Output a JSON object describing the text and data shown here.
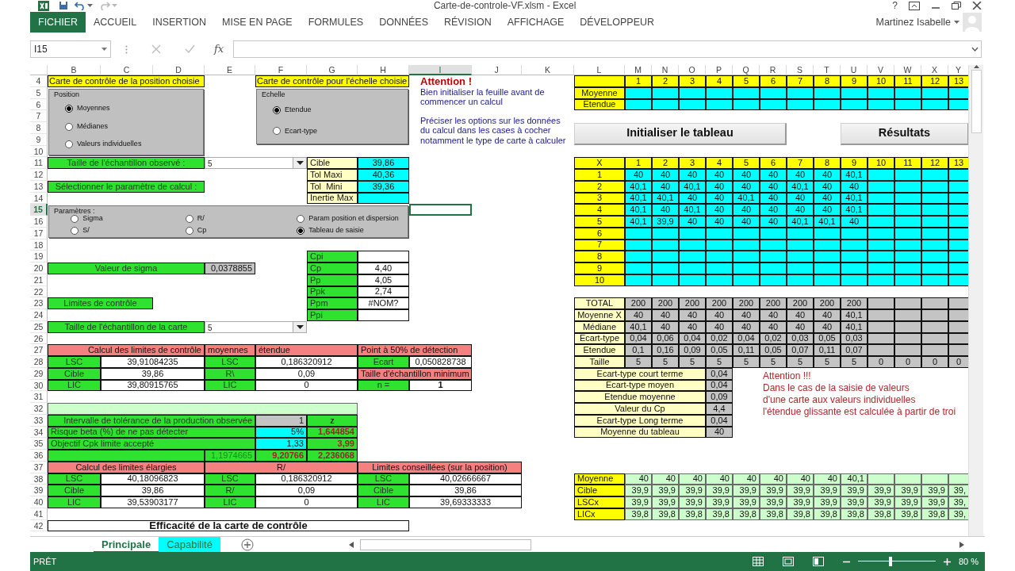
{
  "window": {
    "title": "Carte-de-controle-VF.xlsm - Excel",
    "help": "?"
  },
  "ribbon_tabs": [
    {
      "label": "FICHIER",
      "kind": "file"
    },
    {
      "label": "ACCUEIL",
      "kind": "tab"
    },
    {
      "label": "INSERTION",
      "kind": "tab"
    },
    {
      "label": "MISE EN PAGE",
      "kind": "tab"
    },
    {
      "label": "FORMULES",
      "kind": "tab"
    },
    {
      "label": "DONNÉES",
      "kind": "tab"
    },
    {
      "label": "RÉVISION",
      "kind": "tab"
    },
    {
      "label": "AFFICHAGE",
      "kind": "tab"
    },
    {
      "label": "DÉVELOPPEUR",
      "kind": "tab"
    }
  ],
  "user": "Martinez Isabelle",
  "formula_bar": {
    "name_box": "I15",
    "fx": "fx"
  },
  "columns": [
    {
      "label": "B",
      "selected": false
    },
    {
      "label": "C",
      "selected": false
    },
    {
      "label": "D",
      "selected": false
    },
    {
      "label": "E",
      "selected": false
    },
    {
      "label": "F",
      "selected": false
    },
    {
      "label": "G",
      "selected": false
    },
    {
      "label": "H",
      "selected": false
    },
    {
      "label": "I",
      "selected": true
    },
    {
      "label": "J",
      "selected": false
    },
    {
      "label": "K",
      "selected": false
    },
    {
      "label": "L",
      "selected": false
    },
    {
      "label": "M",
      "selected": false
    },
    {
      "label": "N",
      "selected": false
    },
    {
      "label": "O",
      "selected": false
    },
    {
      "label": "P",
      "selected": false
    },
    {
      "label": "Q",
      "selected": false
    },
    {
      "label": "R",
      "selected": false
    },
    {
      "label": "S",
      "selected": false
    },
    {
      "label": "T",
      "selected": false
    },
    {
      "label": "U",
      "selected": false
    },
    {
      "label": "V",
      "selected": false
    },
    {
      "label": "W",
      "selected": false
    },
    {
      "label": "X",
      "selected": false
    },
    {
      "label": "Y",
      "selected": false
    }
  ],
  "rows": [
    {
      "label": "4",
      "selected": false
    },
    {
      "label": "5",
      "selected": false
    },
    {
      "label": "6",
      "selected": false
    },
    {
      "label": "7",
      "selected": false
    },
    {
      "label": "8",
      "selected": false
    },
    {
      "label": "9",
      "selected": false
    },
    {
      "label": "10",
      "selected": false
    },
    {
      "label": "11",
      "selected": false
    },
    {
      "label": "12",
      "selected": false
    },
    {
      "label": "13",
      "selected": false
    },
    {
      "label": "14",
      "selected": false
    },
    {
      "label": "15",
      "selected": true
    },
    {
      "label": "16",
      "selected": false
    },
    {
      "label": "17",
      "selected": false
    },
    {
      "label": "18",
      "selected": false
    },
    {
      "label": "19",
      "selected": false
    },
    {
      "label": "20",
      "selected": false
    },
    {
      "label": "21",
      "selected": false
    },
    {
      "label": "22",
      "selected": false
    },
    {
      "label": "23",
      "selected": false
    },
    {
      "label": "24",
      "selected": false
    },
    {
      "label": "25",
      "selected": false
    },
    {
      "label": "26",
      "selected": false
    },
    {
      "label": "27",
      "selected": false
    },
    {
      "label": "28",
      "selected": false
    },
    {
      "label": "29",
      "selected": false
    },
    {
      "label": "30",
      "selected": false
    },
    {
      "label": "31",
      "selected": false
    },
    {
      "label": "32",
      "selected": false
    },
    {
      "label": "33",
      "selected": false
    },
    {
      "label": "34",
      "selected": false
    },
    {
      "label": "35",
      "selected": false
    },
    {
      "label": "36",
      "selected": false
    },
    {
      "label": "37",
      "selected": false
    },
    {
      "label": "38",
      "selected": false
    },
    {
      "label": "39",
      "selected": false
    },
    {
      "label": "40",
      "selected": false
    },
    {
      "label": "41",
      "selected": false
    },
    {
      "label": "42",
      "selected": false
    }
  ],
  "option_groups": [
    {
      "legend": "Position",
      "options": [
        {
          "label": "Moyennes",
          "selected": true
        },
        {
          "label": "Médianes",
          "selected": false
        },
        {
          "label": "Valeurs individuelles",
          "selected": false
        }
      ]
    },
    {
      "legend": "Echelle",
      "options": [
        {
          "label": "Etendue",
          "selected": true
        },
        {
          "label": "Ecart-type",
          "selected": false
        }
      ]
    },
    {
      "legend": "Paramètres :",
      "options": [
        {
          "label": "Sigma",
          "selected": false
        },
        {
          "label": "R/",
          "selected": false
        },
        {
          "label": "Param position et dispersion",
          "selected": false
        },
        {
          "label": "S/",
          "selected": false
        },
        {
          "label": "Cp",
          "selected": false
        },
        {
          "label": "Tableau de saisie",
          "selected": true
        }
      ]
    }
  ],
  "notes": [
    {
      "kind": "info",
      "heading": "Attention !",
      "paragraphs": [
        [
          "Bien initialiser la feuille avant de",
          "commencer un calcul"
        ],
        [
          "Préciser les options sur les données",
          "du calcul dans les cases à cocher",
          "notamment le type de carte à calculer"
        ]
      ]
    },
    {
      "kind": "alert",
      "heading": "Attention !!!",
      "paragraphs": [
        [
          "Dans le cas de la saisie de valeurs",
          "d'une carte aux valeurs individuelles",
          "l'étendue glissante est calculée à partir de troi"
        ]
      ]
    }
  ],
  "buttons": [
    {
      "label": "Initialiser le tableau"
    },
    {
      "label": "Résultats"
    }
  ],
  "cells": [
    {
      "kind": "title",
      "text": "Carte de contrôle de la position choisie"
    },
    {
      "kind": "title",
      "text": "Carte de contrôle pour l'échelle choisie"
    },
    {
      "kind": "green",
      "text": "Taille de l'échantillon observé :"
    },
    {
      "kind": "dropdown",
      "text": "5"
    },
    {
      "kind": "tan",
      "text": "Cible"
    },
    {
      "kind": "cyan",
      "text": "39,86"
    },
    {
      "kind": "tan",
      "text": "Tol Maxi"
    },
    {
      "kind": "cyan",
      "text": "40,36"
    },
    {
      "kind": "green",
      "text": "Sélectionner le paramètre de calcul :"
    },
    {
      "kind": "tan",
      "text": "Tol  Mini"
    },
    {
      "kind": "cyan",
      "text": "39,36"
    },
    {
      "kind": "tan",
      "text": "Inertie Max"
    },
    {
      "kind": "cyan"
    },
    {
      "kind": "green",
      "text": "Cpi"
    },
    {
      "kind": "white"
    },
    {
      "kind": "green",
      "text": "Valeur de sigma"
    },
    {
      "kind": "gray",
      "text": "0,0378855"
    },
    {
      "kind": "green",
      "text": "Cp"
    },
    {
      "kind": "white",
      "text": "4,40"
    },
    {
      "kind": "green",
      "text": "Pp"
    },
    {
      "kind": "white",
      "text": "4,05"
    },
    {
      "kind": "green",
      "text": "Ppk"
    },
    {
      "kind": "white",
      "text": "2,74"
    },
    {
      "kind": "green",
      "text": "Limites de contrôle"
    },
    {
      "kind": "green",
      "text": "Ppm"
    },
    {
      "kind": "white",
      "text": "#NOM?"
    },
    {
      "kind": "green",
      "text": "Ppi"
    },
    {
      "kind": "white"
    },
    {
      "kind": "green",
      "text": "Taille de l'échantillon de la carte"
    },
    {
      "kind": "dropdown",
      "text": "5"
    },
    {
      "kind": "pink",
      "text": "Calcul des limites de contrôle"
    },
    {
      "kind": "pink",
      "text": "moyennes"
    },
    {
      "kind": "pink",
      "text": "étendue"
    },
    {
      "kind": "pink",
      "text": "Point à 50% de détection"
    },
    {
      "kind": "green",
      "text": "LSC"
    },
    {
      "kind": "white",
      "text": "39,91084235"
    },
    {
      "kind": "green",
      "text": "LSC"
    },
    {
      "kind": "white",
      "text": "0,186320912"
    },
    {
      "kind": "green",
      "text": "Ecart"
    },
    {
      "kind": "white",
      "text": "0,050828738"
    },
    {
      "kind": "green",
      "text": "Cible"
    },
    {
      "kind": "white",
      "text": "39,86"
    },
    {
      "kind": "green",
      "text": "R\\"
    },
    {
      "kind": "white",
      "text": "0,09"
    },
    {
      "kind": "pink",
      "text": "Taille d'échantillon minimum"
    },
    {
      "kind": "green",
      "text": "LIC"
    },
    {
      "kind": "white",
      "text": "39,80915765"
    },
    {
      "kind": "green",
      "text": "LIC"
    },
    {
      "kind": "white",
      "text": "0"
    },
    {
      "kind": "green",
      "text": "n ="
    },
    {
      "kind": "white",
      "text": "1"
    },
    {
      "kind": "lightgreen"
    },
    {
      "kind": "green",
      "text": "Intervalle de tolérance de la production observée"
    },
    {
      "kind": "gray",
      "text": "1"
    },
    {
      "kind": "green",
      "text": "z"
    },
    {
      "kind": "green",
      "text": "Risque beta (%) de ne pas détecter"
    },
    {
      "kind": "cyan",
      "text": "5%"
    },
    {
      "kind": "green",
      "text": "1,644854"
    },
    {
      "kind": "green",
      "text": "Objectif Cpk limite accepté"
    },
    {
      "kind": "cyan",
      "text": "1,33"
    },
    {
      "kind": "green",
      "text": "3,99"
    },
    {
      "kind": "green"
    },
    {
      "kind": "green",
      "text": "1,1974665"
    },
    {
      "kind": "green",
      "text": "9,20766"
    },
    {
      "kind": "green",
      "text": "2,236068"
    },
    {
      "kind": "pink",
      "text": "Calcul des limites élargies"
    },
    {
      "kind": "pink",
      "text": "R/"
    },
    {
      "kind": "pink",
      "text": "Limites conseillées (sur la position)"
    },
    {
      "kind": "green",
      "text": "LSC"
    },
    {
      "kind": "white",
      "text": "40,18096823"
    },
    {
      "kind": "green",
      "text": "LSC"
    },
    {
      "kind": "white",
      "text": "0,186320912"
    },
    {
      "kind": "green",
      "text": "LSC"
    },
    {
      "kind": "white",
      "text": "40,02666667"
    },
    {
      "kind": "green",
      "text": "Cible"
    },
    {
      "kind": "white",
      "text": "39,86"
    },
    {
      "kind": "green",
      "text": "R/"
    },
    {
      "kind": "white",
      "text": "0,09"
    },
    {
      "kind": "green",
      "text": "Cible"
    },
    {
      "kind": "white",
      "text": "39,86"
    },
    {
      "kind": "green",
      "text": "LIC"
    },
    {
      "kind": "white",
      "text": "39,53903177"
    },
    {
      "kind": "green",
      "text": "LIC"
    },
    {
      "kind": "white",
      "text": "0"
    },
    {
      "kind": "green",
      "text": "LIC"
    },
    {
      "kind": "white",
      "text": "39,69333333"
    },
    {
      "kind": "white",
      "text": "Efficacité de la carte de contrôle"
    },
    {
      "kind": "tan",
      "text": "Ecart-type court terme"
    },
    {
      "kind": "gray",
      "text": "0,04"
    },
    {
      "kind": "tan",
      "text": "Ecart-type moyen"
    },
    {
      "kind": "gray",
      "text": "0,04"
    },
    {
      "kind": "tan",
      "text": "Etendue moyenne"
    },
    {
      "kind": "gray",
      "text": "0,09"
    },
    {
      "kind": "tan",
      "text": "Valeur du Cp"
    },
    {
      "kind": "gray",
      "text": "4,4"
    },
    {
      "kind": "tan",
      "text": "Ecart-type Long terme"
    },
    {
      "kind": "gray",
      "text": "0,04"
    },
    {
      "kind": "tan",
      "text": "Moyenne du tableau"
    },
    {
      "kind": "gray",
      "text": "40"
    }
  ],
  "blocks": [
    {
      "header": [
        "1",
        "2",
        "3",
        "4",
        "5",
        "6",
        "7",
        "8",
        "9",
        "10",
        "11",
        "12",
        "13"
      ],
      "rows": [
        {
          "label": "Moyenne",
          "values": []
        },
        {
          "label": "Etendue",
          "values": []
        }
      ]
    },
    {
      "corner": "X",
      "header": [
        "1",
        "2",
        "3",
        "4",
        "5",
        "6",
        "7",
        "8",
        "9",
        "10",
        "11",
        "12",
        "13"
      ],
      "rows": [
        {
          "label": "1",
          "values": [
            "40",
            "40",
            "40",
            "40",
            "40",
            "40",
            "40",
            "40",
            "40,1"
          ]
        },
        {
          "label": "2",
          "values": [
            "40,1",
            "40",
            "40,1",
            "40",
            "40",
            "40",
            "40,1",
            "40",
            "40"
          ]
        },
        {
          "label": "3",
          "values": [
            "40,1",
            "40,1",
            "40",
            "40",
            "40,1",
            "40",
            "40",
            "40",
            "40,1"
          ]
        },
        {
          "label": "4",
          "values": [
            "40,1",
            "40",
            "40,1",
            "40",
            "40",
            "40",
            "40",
            "40",
            "40,1"
          ]
        },
        {
          "label": "5",
          "values": [
            "40,1",
            "39,9",
            "40",
            "40",
            "40",
            "40",
            "40,1",
            "40,1",
            "40"
          ]
        },
        {
          "label": "6",
          "values": []
        },
        {
          "label": "7",
          "values": []
        },
        {
          "label": "8",
          "values": []
        },
        {
          "label": "9",
          "values": []
        },
        {
          "label": "10",
          "values": []
        }
      ]
    },
    {
      "rows": [
        {
          "label": "TOTAL",
          "values": [
            "200",
            "200",
            "200",
            "200",
            "200",
            "200",
            "200",
            "200",
            "200"
          ]
        },
        {
          "label": "Moyenne X",
          "values": [
            "40",
            "40",
            "40",
            "40",
            "40",
            "40",
            "40",
            "40",
            "40,1"
          ]
        },
        {
          "label": "Médiane",
          "values": [
            "40,1",
            "40",
            "40",
            "40",
            "40",
            "40",
            "40",
            "40",
            "40,1"
          ]
        },
        {
          "label": "Ecart-type",
          "values": [
            "0,04",
            "0,06",
            "0,04",
            "0,02",
            "0,04",
            "0,02",
            "0,03",
            "0,05",
            "0,03"
          ]
        },
        {
          "label": "Etendue",
          "values": [
            "0,1",
            "0,16",
            "0,09",
            "0,05",
            "0,11",
            "0,05",
            "0,07",
            "0,11",
            "0,07"
          ]
        },
        {
          "label": "Taille",
          "values": [
            "5",
            "5",
            "5",
            "5",
            "5",
            "5",
            "5",
            "5",
            "5",
            "0",
            "0",
            "0",
            "0"
          ]
        }
      ]
    },
    {
      "rows": [
        {
          "label": "Moyenne",
          "values": [
            "40",
            "40",
            "40",
            "40",
            "40",
            "40",
            "40",
            "40",
            "40,1"
          ]
        },
        {
          "label": "Cible",
          "values": [
            "39,9",
            "39,9",
            "39,9",
            "39,9",
            "39,9",
            "39,9",
            "39,9",
            "39,9",
            "39,9",
            "39,9",
            "39,9",
            "39,9",
            "39,"
          ]
        },
        {
          "label": "LSCx",
          "values": [
            "39,9",
            "39,9",
            "39,9",
            "39,9",
            "39,9",
            "39,9",
            "39,9",
            "39,9",
            "39,9",
            "39,9",
            "39,9",
            "39,9",
            "39,"
          ]
        },
        {
          "label": "LICx",
          "values": [
            "39,8",
            "39,8",
            "39,8",
            "39,8",
            "39,8",
            "39,8",
            "39,8",
            "39,8",
            "39,8",
            "39,8",
            "39,8",
            "39,8",
            "39,"
          ]
        }
      ]
    }
  ],
  "sheet_tabs": [
    {
      "label": "Principale",
      "selected": true
    },
    {
      "label": "Capabilité",
      "selected": false,
      "color": "#00ffff"
    }
  ],
  "status_bar": {
    "mode": "PRÊT",
    "zoom": "80 %",
    "level": 0.42
  }
}
